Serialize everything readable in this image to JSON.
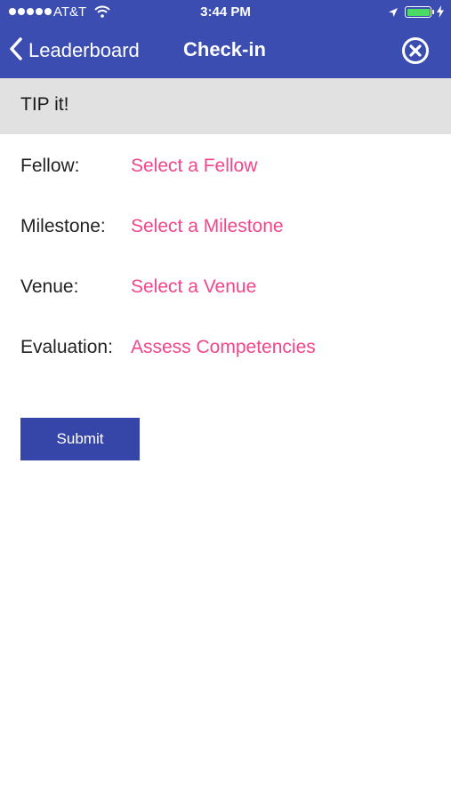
{
  "status_bar": {
    "carrier": "AT&T",
    "time": "3:44 PM",
    "battery_color": "#4cd964"
  },
  "nav": {
    "back_label": "Leaderboard",
    "title": "Check-in",
    "back_icon": "chevron-left-icon",
    "close_icon": "close-circle-icon"
  },
  "section": {
    "title": "TIP it!"
  },
  "form": {
    "rows": [
      {
        "label": "Fellow:",
        "value": "Select a Fellow"
      },
      {
        "label": "Milestone:",
        "value": "Select a Milestone"
      },
      {
        "label": "Venue:",
        "value": "Select a Venue"
      },
      {
        "label": "Evaluation:",
        "value": "Assess Competencies"
      }
    ],
    "submit_label": "Submit"
  },
  "colors": {
    "nav_background": "#3b4db0",
    "link_pink": "#f2468b",
    "button_background": "#3646a8",
    "section_header_background": "#e1e1e1"
  }
}
